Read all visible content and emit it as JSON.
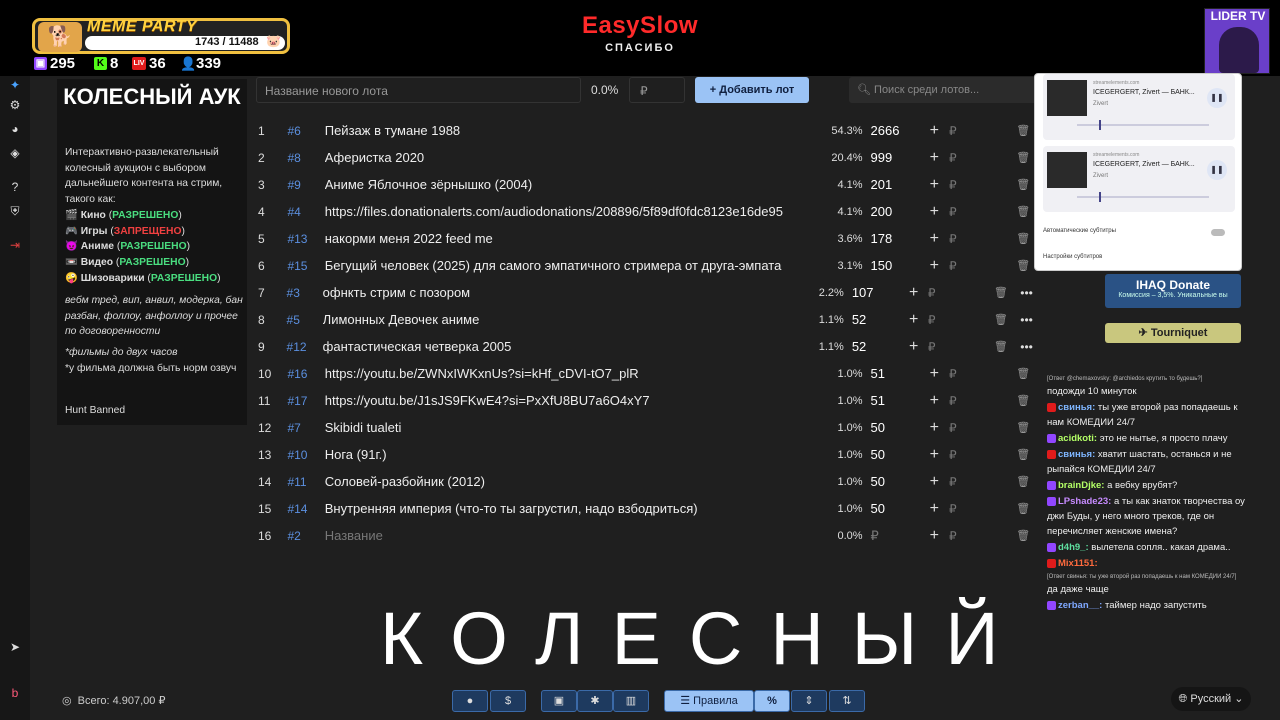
{
  "header": {
    "meme_title": "MEME PARTY",
    "meme_count": "1743 / 11488",
    "meme_pig": "🐷",
    "stats": [
      {
        "icon": "twitch-icon",
        "value": "295",
        "color": "#9146ff"
      },
      {
        "icon": "kick-icon",
        "value": "8",
        "color": "#53fc18"
      },
      {
        "icon": "live-icon",
        "value": "36",
        "color": "#e01b1b"
      },
      {
        "icon": "viewers-icon",
        "value": "339",
        "color": "#4aa3ff"
      }
    ],
    "brand_name": "EasySlow",
    "brand_sub": "СПАСИБО",
    "channel": "LIDER TV"
  },
  "description": {
    "title": "КОЛЕСНЫЙ АУК",
    "intro": "Интерактивно-развлекательный колесный аукцион с выбором дальнейшего контента на стрим, такого как:",
    "items": [
      {
        "icon": "🎬",
        "name": "Кино",
        "status": "РАЗРЕШЕНО",
        "allowed": true
      },
      {
        "icon": "🎮",
        "name": "Игры",
        "status": "ЗАПРЕЩЕНО",
        "allowed": false
      },
      {
        "icon": "😈",
        "name": "Аниме",
        "status": "РАЗРЕШЕНО",
        "allowed": true
      },
      {
        "icon": "📼",
        "name": "Видео",
        "status": "РАЗРЕШЕНО",
        "allowed": true
      },
      {
        "icon": "🤪",
        "name": "Шизоварики",
        "status": "РАЗРЕШЕНО",
        "allowed": true
      }
    ],
    "rules": "вебм тред, вип, анвил, модерка, бан разбан, фоллоу, анфоллоу и прочее по договоренности",
    "note1": "*фильмы до двух часов",
    "note2": "*у фильма должна быть норм озвуч",
    "hunt": "Hunt Banned"
  },
  "toolbar": {
    "lot_placeholder": "Название нового лота",
    "percent": "0.0%",
    "currency": "₽",
    "add_label": "Добавить лот",
    "search_placeholder": "Поиск среди лотов..."
  },
  "lots": [
    {
      "n": "1",
      "id": "#6",
      "title": "Пейзаж в тумане 1988",
      "pct": "54.3%",
      "value": "2666"
    },
    {
      "n": "2",
      "id": "#8",
      "title": "Аферистка 2020",
      "pct": "20.4%",
      "value": "999"
    },
    {
      "n": "3",
      "id": "#9",
      "title": "Аниме Яблочное зёрнышко (2004)",
      "pct": "4.1%",
      "value": "201"
    },
    {
      "n": "4",
      "id": "#4",
      "title": "https://files.donationalerts.com/audiodonations/208896/5f89df0fdc8123e16de95",
      "pct": "4.1%",
      "value": "200"
    },
    {
      "n": "5",
      "id": "#13",
      "title": "накорми меня 2022 feed me",
      "pct": "3.6%",
      "value": "178"
    },
    {
      "n": "6",
      "id": "#15",
      "title": "Бегущий человек (2025) для самого эмпатичного стримера от друга-эмпата",
      "pct": "3.1%",
      "value": "150"
    },
    {
      "n": "7",
      "id": "#3",
      "title": "офнкть стрим с позором",
      "pct": "2.2%",
      "value": "107"
    },
    {
      "n": "8",
      "id": "#5",
      "title": "Лимонных Девочек аниме",
      "pct": "1.1%",
      "value": "52"
    },
    {
      "n": "9",
      "id": "#12",
      "title": "фантастическая четверка 2005",
      "pct": "1.1%",
      "value": "52"
    },
    {
      "n": "10",
      "id": "#16",
      "title": "https://youtu.be/ZWNxIWKxnUs?si=kHf_cDVI-tO7_plR",
      "pct": "1.0%",
      "value": "51"
    },
    {
      "n": "11",
      "id": "#17",
      "title": "https://youtu.be/J1sJS9FKwE4?si=PxXfU8BU7a6O4xY7",
      "pct": "1.0%",
      "value": "51"
    },
    {
      "n": "12",
      "id": "#7",
      "title": "Skibidi tualeti",
      "pct": "1.0%",
      "value": "50"
    },
    {
      "n": "13",
      "id": "#10",
      "title": "Нога (91г.)",
      "pct": "1.0%",
      "value": "50"
    },
    {
      "n": "14",
      "id": "#11",
      "title": "Соловей-разбойник (2012)",
      "pct": "1.0%",
      "value": "50"
    },
    {
      "n": "15",
      "id": "#14",
      "title": "Внутренняя империя (что-то ты загрустил, надо взбодриться)",
      "pct": "1.0%",
      "value": "50"
    },
    {
      "n": "16",
      "id": "#2",
      "title": "Название",
      "pct": "0.0%",
      "value": "₽"
    }
  ],
  "overlay_text": "КОЛЕСНЫЙ",
  "footer": {
    "total": "Всего: 4.907,00 ₽",
    "rules_label": "Правила",
    "language": "Русский"
  },
  "media": [
    {
      "source": "streamelements.com",
      "title": "ICEGERGERT, Zivert — БАНК...",
      "artist": "Zivert"
    },
    {
      "source": "streamelements.com",
      "title": "ICEGERGERT, Zivert — БАНК...",
      "artist": "Zivert"
    }
  ],
  "media_settings": {
    "auto_subs": "Автоматические субтитры",
    "subs_settings": "Настройки субтитров"
  },
  "donate": {
    "title": "IHAQ Donate",
    "sub": "Комиссия – 3,5%. Уникальные вы",
    "tournament": "Tourniquet"
  },
  "chat": [
    {
      "system": "[Ответ @chemaxovsky: @archiedos крутить то будешь?]",
      "user": "",
      "text": "подожди 10 минуток",
      "color": "#ffffff",
      "platform": ""
    },
    {
      "system": "",
      "user": "свинья:",
      "text": "ты уже второй раз попадаешь к нам КОМЕДИИ 24/7",
      "color": "#7fb6ff",
      "platform": "#e01b1b"
    },
    {
      "system": "",
      "user": "acidkoti:",
      "text": "это не нытье, я просто плачу",
      "color": "#b3ff66",
      "platform": "#9146ff"
    },
    {
      "system": "",
      "user": "свинья:",
      "text": "хватит шастать, останься и не рыпайся КОМЕДИИ 24/7",
      "color": "#7fb6ff",
      "platform": "#e01b1b"
    },
    {
      "system": "",
      "user": "brainDjke:",
      "text": "а вебку врубят?",
      "color": "#b3ff66",
      "platform": "#9146ff"
    },
    {
      "system": "",
      "user": "LPshade23:",
      "text": "а ты как знаток творчества оу джи Буды, у него много треков, где он перечисляет женские имена?",
      "color": "#c78bff",
      "platform": "#9146ff"
    },
    {
      "system": "",
      "user": "d4h9_:",
      "text": "вылетела сопля.. какая драма..",
      "color": "#5fe0a0",
      "platform": "#9146ff"
    },
    {
      "system": "",
      "user": "Mix1151:",
      "text": "",
      "color": "#ff6a3d",
      "platform": "#e01b1b"
    },
    {
      "system": "[Ответ свинья: ты уже второй раз попадаешь к нам КОМЕДИИ 24/7]",
      "user": "",
      "text": "да даже чаще",
      "color": "#ffffff",
      "platform": ""
    },
    {
      "system": "",
      "user": "zerban__:",
      "text": "таймер надо запустить",
      "color": "#7fa8ff",
      "platform": "#9146ff"
    }
  ]
}
